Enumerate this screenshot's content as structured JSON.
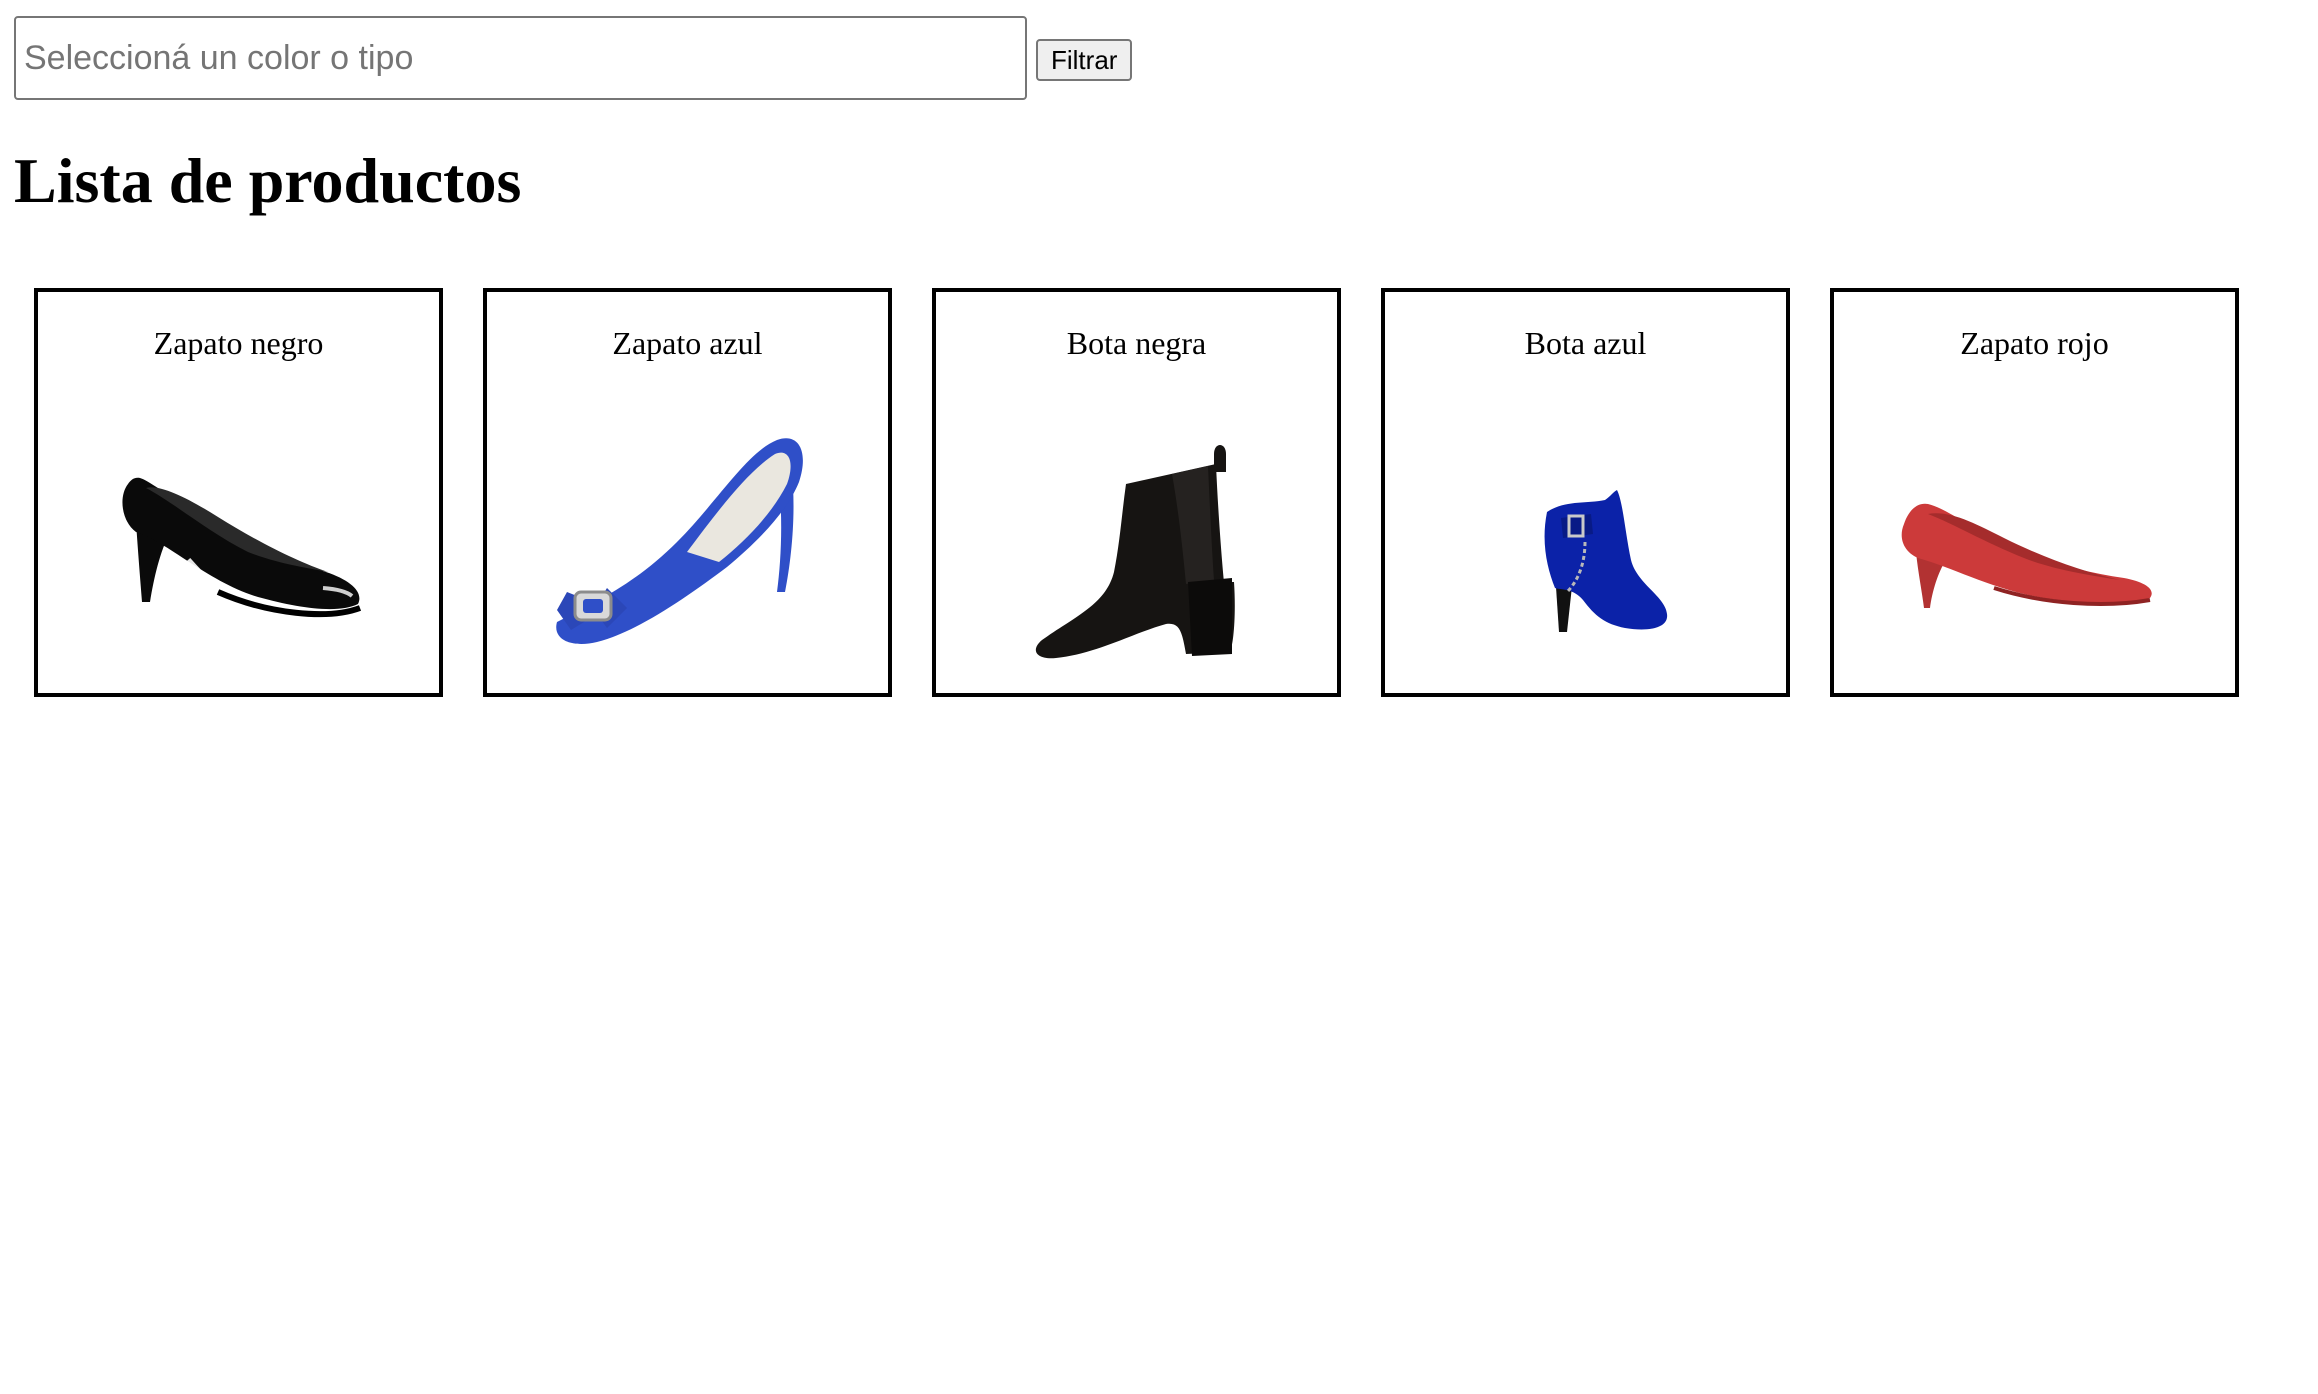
{
  "filter": {
    "placeholder": "Seleccioná un color o tipo",
    "value": "",
    "button_label": "Filtrar"
  },
  "heading": "Lista de productos",
  "products": [
    {
      "name": "Zapato negro",
      "image_icon": "black-pump-shoe-image",
      "color": "#0a0a0a"
    },
    {
      "name": "Zapato azul",
      "image_icon": "blue-pump-shoe-image",
      "color": "#2f4fc8"
    },
    {
      "name": "Bota negra",
      "image_icon": "black-ankle-boot-image",
      "color": "#161412"
    },
    {
      "name": "Bota azul",
      "image_icon": "blue-ankle-boot-image",
      "color": "#0b22a8"
    },
    {
      "name": "Zapato rojo",
      "image_icon": "red-pump-shoe-image",
      "color": "#cc3a3a"
    }
  ]
}
